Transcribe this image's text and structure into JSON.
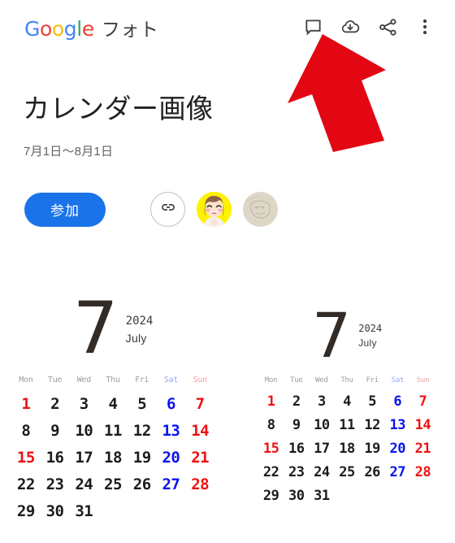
{
  "appbar": {
    "brand_google_letters": [
      "G",
      "o",
      "o",
      "g",
      "l",
      "e"
    ],
    "brand_suffix": "フォト",
    "actions": [
      {
        "name": "comment-icon",
        "label": "コメント"
      },
      {
        "name": "download-icon",
        "label": "ダウンロード"
      },
      {
        "name": "share-icon",
        "label": "共有"
      },
      {
        "name": "more-icon",
        "label": "その他のオプション"
      }
    ]
  },
  "album": {
    "title": "カレンダー画像",
    "date_range": "7月1日〜8月1日"
  },
  "actions": {
    "join_label": "参加",
    "link_icon": "link-icon",
    "members": [
      {
        "name": "avatar-girl",
        "kind": "cartoon-girl"
      },
      {
        "name": "avatar-stone",
        "kind": "clay-stone"
      }
    ]
  },
  "overlay": {
    "arrow_color": "#e30613",
    "arrow_points_at": "download-icon"
  },
  "photos": [
    {
      "id": "calendar-left",
      "month_number": "7",
      "year": "2024",
      "month_name": "July",
      "weekdays": [
        "Mon",
        "Tue",
        "Wed",
        "Thu",
        "Fri",
        "Sat",
        "Sun"
      ],
      "weeks": [
        [
          "1",
          "2",
          "3",
          "4",
          "5",
          "6",
          "7"
        ],
        [
          "8",
          "9",
          "10",
          "11",
          "12",
          "13",
          "14"
        ],
        [
          "15",
          "16",
          "17",
          "18",
          "19",
          "20",
          "21"
        ],
        [
          "22",
          "23",
          "24",
          "25",
          "26",
          "27",
          "28"
        ],
        [
          "29",
          "30",
          "31",
          "",
          "",
          "",
          ""
        ]
      ],
      "holidays": [
        "15"
      ]
    },
    {
      "id": "calendar-right",
      "month_number": "7",
      "year": "2024",
      "month_name": "July",
      "weekdays": [
        "Mon",
        "Tue",
        "Wed",
        "Thu",
        "Fri",
        "Sat",
        "Sun"
      ],
      "weeks": [
        [
          "1",
          "2",
          "3",
          "4",
          "5",
          "6",
          "7"
        ],
        [
          "8",
          "9",
          "10",
          "11",
          "12",
          "13",
          "14"
        ],
        [
          "15",
          "16",
          "17",
          "18",
          "19",
          "20",
          "21"
        ],
        [
          "22",
          "23",
          "24",
          "25",
          "26",
          "27",
          "28"
        ],
        [
          "29",
          "30",
          "31",
          "",
          "",
          "",
          ""
        ]
      ],
      "holidays": [
        "15"
      ]
    }
  ],
  "colors": {
    "accent_blue": "#1a73e8",
    "saturday": "#0a12f0",
    "sunday": "#ee1111",
    "arrow_red": "#e30613",
    "ink": "#322c28"
  }
}
